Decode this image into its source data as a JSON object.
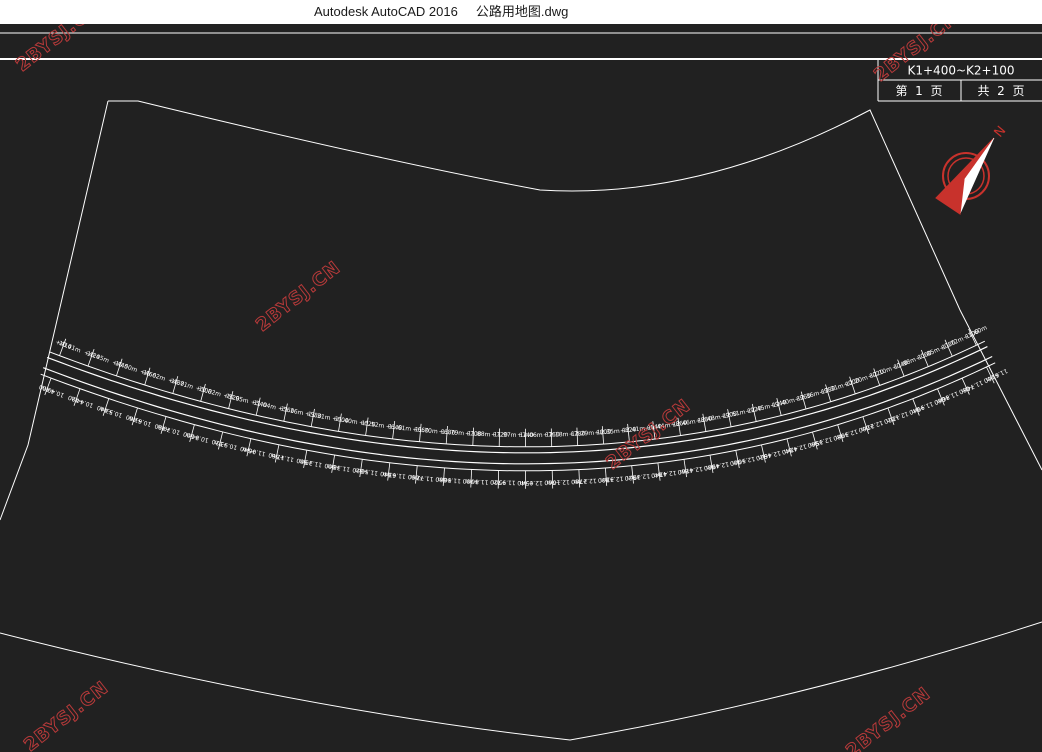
{
  "window": {
    "title": "Autodesk AutoCAD 2016     公路用地图.dwg"
  },
  "title_block": {
    "range": "K1+400~K2+100",
    "page_current_label": "第  1  页",
    "page_total_label": "共  2  页"
  },
  "north_arrow": {
    "label": "N",
    "icon": "north-arrow-icon"
  },
  "watermark": {
    "text": "2BYSJ.CN",
    "color": "#b83a3a"
  },
  "colors": {
    "background": "#212121",
    "linework": "#ffffff",
    "accent": "#c8322c"
  },
  "stations_top": [
    "+410",
    "+420",
    "+440",
    "+460",
    "+480",
    "+500",
    "+520",
    "+540",
    "+560",
    "+580",
    "+600",
    "+620",
    "+640",
    "+660",
    "+680",
    "+700",
    "+720",
    "+740",
    "+760",
    "+780",
    "+800",
    "+820",
    "+840",
    "+860",
    "+880",
    "+900",
    "+920",
    "+940",
    "+960",
    "+980",
    "+000",
    "+020",
    "+040",
    "+060",
    "+080",
    "+100"
  ],
  "stations_bottom": [
    "+400",
    "+420",
    "+440",
    "+460",
    "+480",
    "+500",
    "+520",
    "+540",
    "+560",
    "+580",
    "+600",
    "+620",
    "+640",
    "+660",
    "+680",
    "+700",
    "+720",
    "+740",
    "+760",
    "+780",
    "+800",
    "+820",
    "+840",
    "+860",
    "+880",
    "+900",
    "+920",
    "+940",
    "+960",
    "+980",
    "+000",
    "+020",
    "+040",
    "+060",
    "+080",
    "+100"
  ],
  "widths_top": [
    "10.41m",
    "10.45m",
    "10.50m",
    "10.62m",
    "10.71m",
    "10.82m",
    "10.95m",
    "11.04m",
    "11.16m",
    "11.31m",
    "11.40m",
    "11.52m",
    "11.61m",
    "11.70m",
    "11.79m",
    "11.88m",
    "11.97m",
    "12.06m",
    "12.18m",
    "12.29m",
    "12.35m",
    "12.41m",
    "12.44m",
    "12.46m",
    "12.48m",
    "12.51m",
    "12.45m",
    "12.40m",
    "12.36m",
    "12.31m",
    "12.20m",
    "12.10m",
    "11.98m",
    "11.85m",
    "11.72m",
    "11.60m"
  ],
  "widths_bottom": [
    "10.40m",
    "10.44m",
    "10.53m",
    "10.61m",
    "10.70m",
    "10.84m",
    "10.93m",
    "11.06m",
    "11.17m",
    "11.29m",
    "11.38m",
    "11.50m",
    "11.63m",
    "11.72m",
    "11.80m",
    "11.86m",
    "11.95m",
    "12.05m",
    "12.16m",
    "12.27m",
    "12.33m",
    "12.39m",
    "12.43m",
    "12.47m",
    "12.49m",
    "12.50m",
    "12.46m",
    "12.42m",
    "12.35m",
    "12.30m",
    "12.22m",
    "12.12m",
    "11.99m",
    "11.86m",
    "11.74m",
    "11.62m"
  ]
}
